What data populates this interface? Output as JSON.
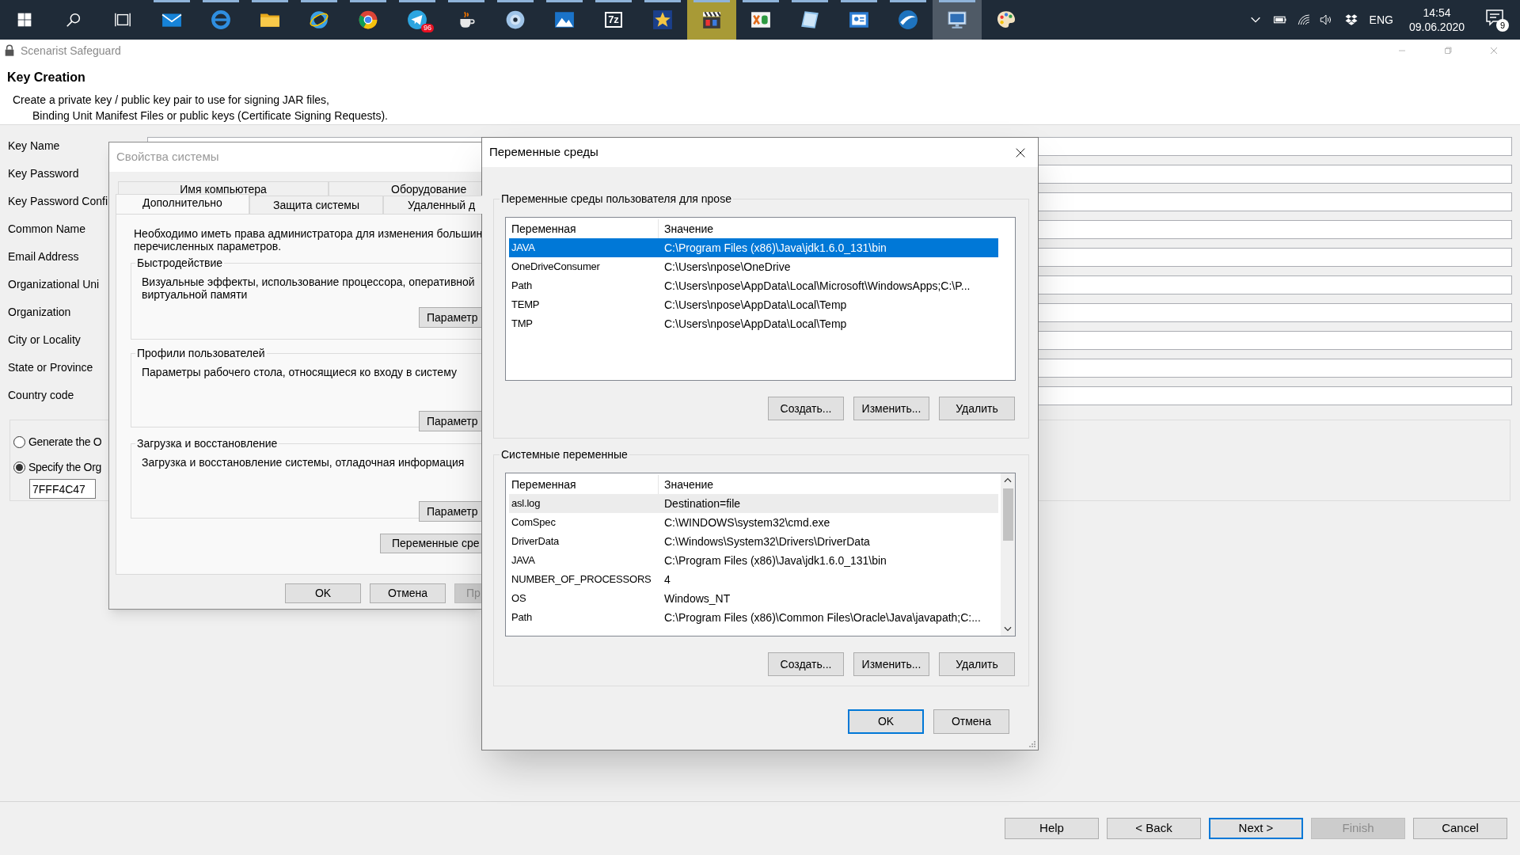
{
  "taskbar": {
    "buttons": [
      {
        "kind": "start"
      },
      {
        "kind": "search"
      },
      {
        "kind": "task_view"
      }
    ],
    "apps": [
      {
        "kind": "mail",
        "running": true,
        "selected": false,
        "attention": false
      },
      {
        "kind": "edge",
        "running": true,
        "selected": false,
        "attention": false
      },
      {
        "kind": "explorer",
        "running": true,
        "selected": false,
        "attention": false
      },
      {
        "kind": "ie",
        "running": true,
        "selected": false,
        "attention": false
      },
      {
        "kind": "chrome",
        "running": true,
        "selected": false,
        "attention": false
      },
      {
        "kind": "telegram",
        "running": true,
        "selected": false,
        "attention": false,
        "badge": "96"
      },
      {
        "kind": "java",
        "running": true,
        "selected": false,
        "attention": false
      },
      {
        "kind": "disc",
        "running": true,
        "selected": false,
        "attention": false
      },
      {
        "kind": "photos",
        "running": true,
        "selected": false,
        "attention": false
      },
      {
        "kind": "archive",
        "running": true,
        "selected": false,
        "attention": false,
        "label": "7z"
      },
      {
        "kind": "star",
        "running": true,
        "selected": false,
        "attention": false
      },
      {
        "kind": "clapper",
        "running": true,
        "selected": false,
        "attention": true
      },
      {
        "kind": "xd",
        "running": true,
        "selected": false,
        "attention": false
      },
      {
        "kind": "notes",
        "running": true,
        "selected": false,
        "attention": false
      },
      {
        "kind": "contacts",
        "running": true,
        "selected": false,
        "attention": false
      },
      {
        "kind": "globe",
        "running": true,
        "selected": false,
        "attention": false
      },
      {
        "kind": "remote",
        "running": true,
        "selected": true,
        "attention": false
      },
      {
        "kind": "paint",
        "running": false,
        "selected": false,
        "attention": false
      }
    ],
    "tray": {
      "language": "ENG",
      "time": "14:54",
      "date": "09.06.2020",
      "notification_count": "9"
    }
  },
  "app_window": {
    "title": "Scenarist Safeguard",
    "page_title": "Key Creation",
    "description": [
      "Create a private key / public key pair to use for signing JAR files,",
      "Binding Unit Manifest Files or public keys (Certificate Signing Requests)."
    ],
    "fields": [
      {
        "label": "Key Name"
      },
      {
        "label": "Key Password"
      },
      {
        "label": "Key Password Confi"
      },
      {
        "label": "Common Name"
      },
      {
        "label": "Email Address"
      },
      {
        "label": "Organizational Uni"
      },
      {
        "label": "Organization"
      },
      {
        "label": "City or Locality"
      },
      {
        "label": "State or Province"
      },
      {
        "label": "Country code"
      }
    ],
    "org_id_options": [
      {
        "label": "Generate the O",
        "selected": false
      },
      {
        "label": "Specify the Org",
        "selected": true
      }
    ],
    "org_id_value": "7FFF4C47",
    "buttons": [
      {
        "label": "Help",
        "disabled": false,
        "focused": false
      },
      {
        "label": "< Back",
        "disabled": false,
        "focused": false
      },
      {
        "label": "Next >",
        "disabled": false,
        "focused": true
      },
      {
        "label": "Finish",
        "disabled": true,
        "focused": false
      },
      {
        "label": "Cancel",
        "disabled": false,
        "focused": false
      }
    ]
  },
  "system_properties": {
    "title": "Свойства системы",
    "tabs_back_row": [
      {
        "label": "Имя компьютера",
        "selected": false
      },
      {
        "label": "Оборудование",
        "selected": false
      }
    ],
    "tabs_front_row": [
      {
        "label": "Дополнительно",
        "selected": true
      },
      {
        "label": "Защита системы",
        "selected": false
      },
      {
        "label": "Удаленный д",
        "selected": false
      }
    ],
    "note": [
      "Необходимо иметь права администратора для изменения большин",
      "перечисленных параметров."
    ],
    "groups": [
      {
        "title": "Быстродействие",
        "text": [
          "Визуальные эффекты, использование процессора, оперативной",
          "виртуальной памяти"
        ],
        "button": "Параметр"
      },
      {
        "title": "Профили пользователей",
        "text": [
          "Параметры рабочего стола, относящиеся ко входу в систему"
        ],
        "button": "Параметр"
      },
      {
        "title": "Загрузка и восстановление",
        "text": [
          "Загрузка и восстановление системы, отладочная информация"
        ],
        "button": "Параметр"
      }
    ],
    "env_button": "Переменные сре",
    "buttons": [
      {
        "label": "OK",
        "disabled": false
      },
      {
        "label": "Отмена",
        "disabled": false
      },
      {
        "label": "Пр",
        "disabled": true
      }
    ]
  },
  "environment_variables": {
    "title": "Переменные среды",
    "user_group": {
      "title": "Переменные среды пользователя для npose",
      "columns": [
        "Переменная",
        "Значение"
      ],
      "rows": [
        {
          "name": "JAVA",
          "value": "C:\\Program Files (x86)\\Java\\jdk1.6.0_131\\bin",
          "selected": true,
          "hovered": false
        },
        {
          "name": "OneDriveConsumer",
          "value": "C:\\Users\\npose\\OneDrive",
          "selected": false,
          "hovered": false
        },
        {
          "name": "Path",
          "value": "C:\\Users\\npose\\AppData\\Local\\Microsoft\\WindowsApps;C:\\P...",
          "selected": false,
          "hovered": false
        },
        {
          "name": "TEMP",
          "value": "C:\\Users\\npose\\AppData\\Local\\Temp",
          "selected": false,
          "hovered": false
        },
        {
          "name": "TMP",
          "value": "C:\\Users\\npose\\AppData\\Local\\Temp",
          "selected": false,
          "hovered": false
        }
      ],
      "buttons": [
        "Создать...",
        "Изменить...",
        "Удалить"
      ]
    },
    "system_group": {
      "title": "Системные переменные",
      "columns": [
        "Переменная",
        "Значение"
      ],
      "rows": [
        {
          "name": "asl.log",
          "value": "Destination=file",
          "selected": false,
          "hovered": true
        },
        {
          "name": "ComSpec",
          "value": "C:\\WINDOWS\\system32\\cmd.exe",
          "selected": false,
          "hovered": false
        },
        {
          "name": "DriverData",
          "value": "C:\\Windows\\System32\\Drivers\\DriverData",
          "selected": false,
          "hovered": false
        },
        {
          "name": "JAVA",
          "value": "C:\\Program Files (x86)\\Java\\jdk1.6.0_131\\bin",
          "selected": false,
          "hovered": false
        },
        {
          "name": "NUMBER_OF_PROCESSORS",
          "value": "4",
          "selected": false,
          "hovered": false
        },
        {
          "name": "OS",
          "value": "Windows_NT",
          "selected": false,
          "hovered": false
        },
        {
          "name": "Path",
          "value": "C:\\Program Files (x86)\\Common Files\\Oracle\\Java\\javapath;C:...",
          "selected": false,
          "hovered": false
        }
      ],
      "buttons": [
        "Создать...",
        "Изменить...",
        "Удалить"
      ]
    },
    "buttons": [
      {
        "label": "OK",
        "focused": true
      },
      {
        "label": "Отмена",
        "focused": false
      }
    ]
  }
}
